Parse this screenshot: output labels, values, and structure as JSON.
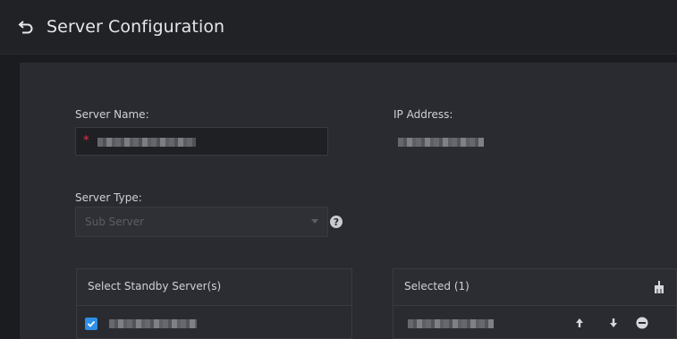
{
  "header": {
    "title": "Server Configuration",
    "back_icon": "back-arrow-icon"
  },
  "form": {
    "server_name_label": "Server Name:",
    "server_name_required_mark": "*",
    "ip_address_label": "IP Address:",
    "server_type_label": "Server Type:",
    "server_type_value": "Sub Server",
    "help_glyph": "?"
  },
  "standby_panel": {
    "title": "Select Standby Server(s)"
  },
  "selected_panel": {
    "title": "Selected (1)",
    "clear_icon": "broom-icon",
    "row_actions": [
      "move-up-icon",
      "move-down-icon",
      "remove-icon"
    ]
  },
  "colors": {
    "accent": "#2f8fe8",
    "required": "#e0364a",
    "background": "#1b1c20",
    "panel": "#2a2b30"
  }
}
